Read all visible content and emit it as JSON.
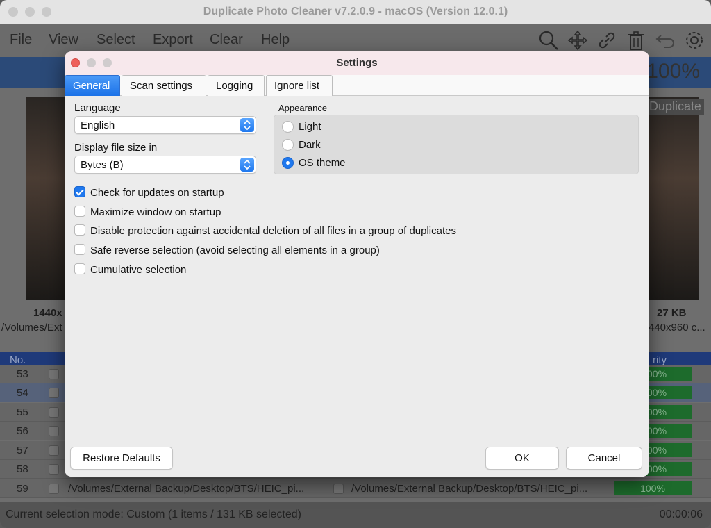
{
  "app": {
    "title": "Duplicate Photo Cleaner v7.2.0.9 - macOS (Version 12.0.1)",
    "menu": [
      "File",
      "View",
      "Select",
      "Export",
      "Clear",
      "Help"
    ],
    "toolbar_icons": [
      "search-icon",
      "move-icon",
      "link-icon",
      "trash-icon",
      "undo-icon",
      "gear-icon"
    ],
    "similarity_header_pct": "100%",
    "duplicate_tag": "Duplicate",
    "left_photo": {
      "dims": "1440x",
      "path": "/Volumes/Ext"
    },
    "right_photo": {
      "size": "27 KB",
      "dims": "440x960 c..."
    },
    "table": {
      "header_no": "No.",
      "header_similarity": "rity",
      "rows": [
        {
          "no": "53",
          "similarity": "00%"
        },
        {
          "no": "54",
          "similarity": "00%"
        },
        {
          "no": "55",
          "similarity": "00%"
        },
        {
          "no": "56",
          "similarity": "00%"
        },
        {
          "no": "57",
          "similarity": "00%"
        },
        {
          "no": "58",
          "similarity": "00%"
        },
        {
          "no": "59",
          "path_left": "/Volumes/External Backup/Desktop/BTS/HEIC_pi...",
          "path_right": "/Volumes/External Backup/Desktop/BTS/HEIC_pi...",
          "similarity": "100%"
        }
      ]
    },
    "status": "Current selection mode: Custom (1 items / 131 KB selected)",
    "timer": "00:00:06"
  },
  "dialog": {
    "title": "Settings",
    "tabs": [
      "General",
      "Scan settings",
      "Logging",
      "Ignore list"
    ],
    "active_tab": "General",
    "language_label": "Language",
    "language_value": "English",
    "filesize_label": "Display file size in",
    "filesize_value": "Bytes (B)",
    "appearance_label": "Appearance",
    "appearance_options": [
      "Light",
      "Dark",
      "OS theme"
    ],
    "appearance_selected": "OS theme",
    "checkboxes": [
      {
        "label": "Check for updates on startup",
        "checked": true
      },
      {
        "label": "Maximize window on startup",
        "checked": false
      },
      {
        "label": "Disable protection against accidental deletion of all files in a group of duplicates",
        "checked": false
      },
      {
        "label": "Safe reverse selection (avoid selecting all elements in a group)",
        "checked": false
      },
      {
        "label": "Cumulative selection",
        "checked": false
      }
    ],
    "restore_defaults": "Restore Defaults",
    "ok": "OK",
    "cancel": "Cancel"
  },
  "colors": {
    "accent": "#1f78ee",
    "close": "#ee5f5b",
    "similarity_green": "#1d6b2c"
  }
}
